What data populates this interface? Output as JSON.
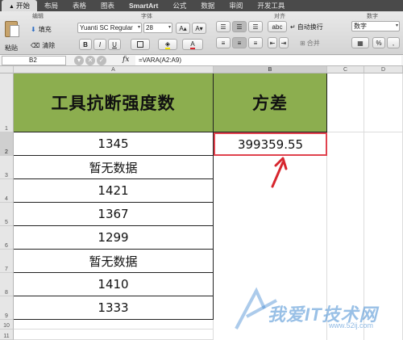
{
  "ribbon": {
    "tabs": [
      "开始",
      "布局",
      "表格",
      "图表",
      "SmartArt",
      "公式",
      "数据",
      "审阅",
      "开发工具"
    ],
    "groups": {
      "edit": "编辑",
      "font": "字体",
      "align": "对齐",
      "number": "数字"
    },
    "paste_label": "粘贴",
    "fill_label": "填充",
    "clear_label": "清除",
    "font_name": "Yuanti SC Regular",
    "font_size": "28",
    "bold": "B",
    "italic": "I",
    "underline": "U",
    "wrap_label": "自动换行",
    "merge_label": "合并",
    "number_format": "数字",
    "abc_label": "abc",
    "percent": "%"
  },
  "formula_bar": {
    "cell_ref": "B2",
    "fx": "fx",
    "formula": "=VARA(A2:A9)"
  },
  "columns": [
    "A",
    "B",
    "C",
    "D"
  ],
  "rows": [
    "1",
    "2",
    "3",
    "4",
    "5",
    "6",
    "7",
    "8",
    "9",
    "10",
    "11"
  ],
  "sheet": {
    "header_a": "工具抗断强度数",
    "header_b": "方差",
    "a_values": [
      "1345",
      "暂无数据",
      "1421",
      "1367",
      "1299",
      "暂无数据",
      "1410",
      "1333"
    ],
    "b2": "399359.55"
  },
  "watermark": {
    "text": "我爱IT技术网",
    "url": "www.52ij.com"
  },
  "colors": {
    "header_fill": "#8cae4f",
    "selection": "#e0424e",
    "arrow": "#d7262e"
  }
}
